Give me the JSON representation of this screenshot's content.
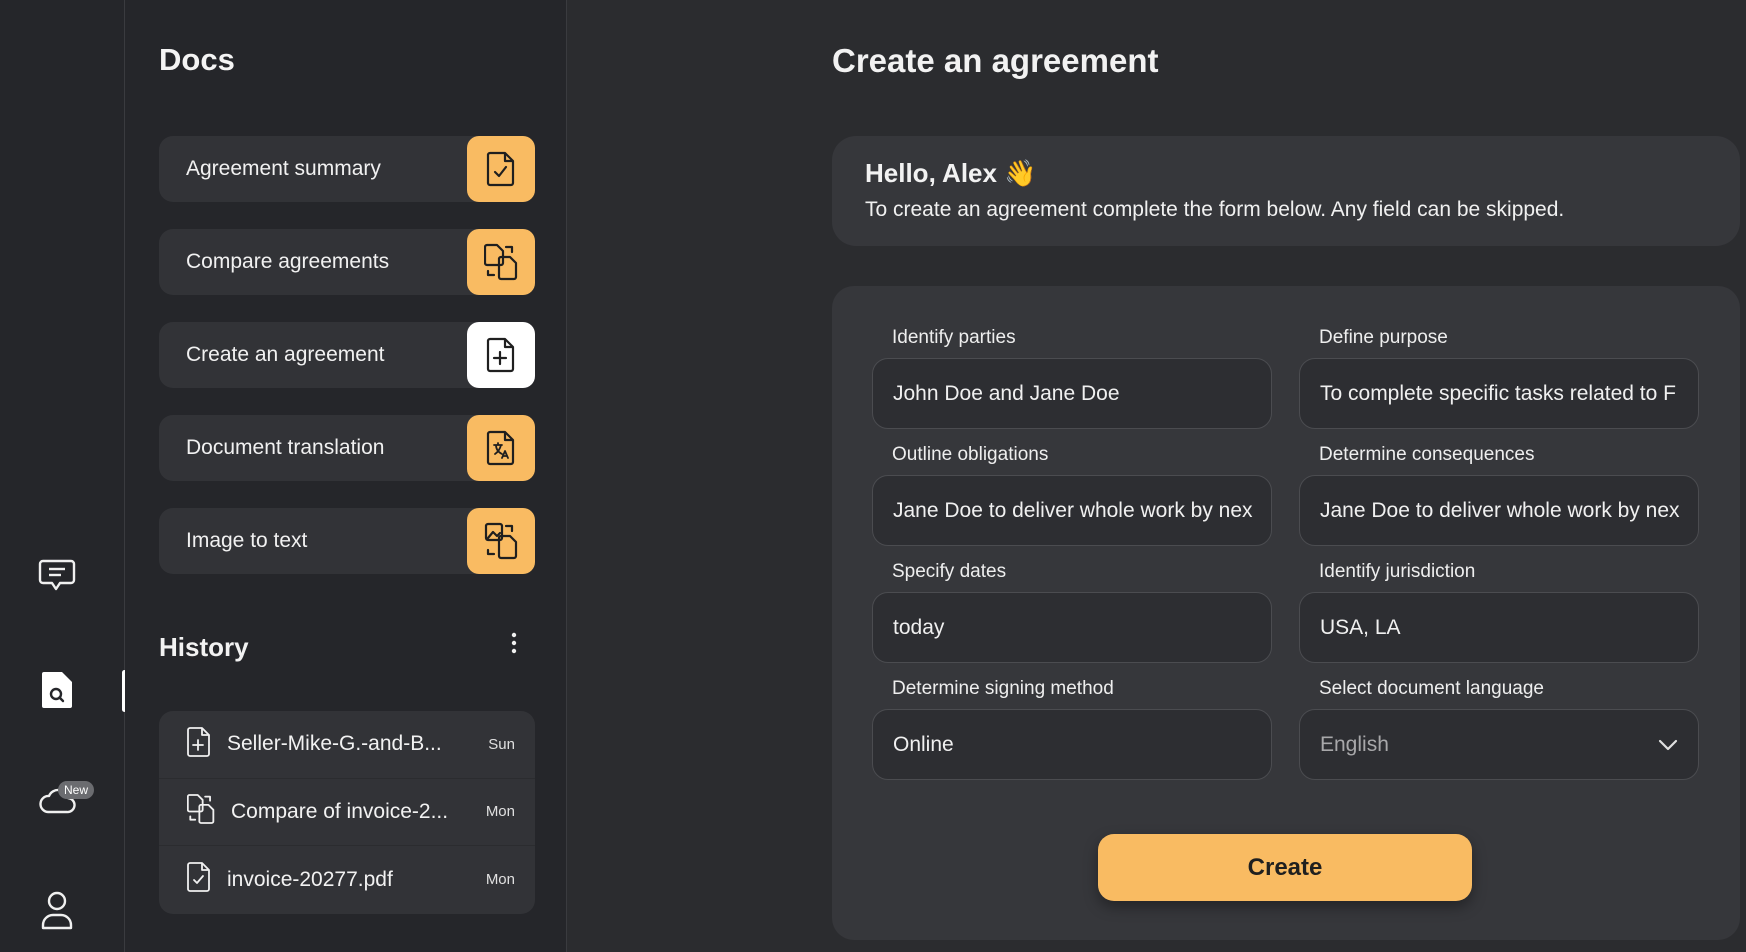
{
  "rail": {
    "items": [
      {
        "name": "chat",
        "icon": "chat-icon"
      },
      {
        "name": "docs",
        "icon": "doc-search-icon",
        "active": true
      },
      {
        "name": "cloud",
        "icon": "cloud-icon",
        "badge": "New"
      },
      {
        "name": "profile",
        "icon": "user-icon"
      }
    ]
  },
  "docs": {
    "title": "Docs",
    "tools": [
      {
        "label": "Agreement summary",
        "icon": "doc-check-icon"
      },
      {
        "label": "Compare agreements",
        "icon": "doc-compare-icon"
      },
      {
        "label": "Create an agreement",
        "icon": "doc-plus-icon",
        "active": true
      },
      {
        "label": "Document translation",
        "icon": "doc-translate-icon"
      },
      {
        "label": "Image to text",
        "icon": "image-text-icon"
      }
    ]
  },
  "history": {
    "title": "History",
    "items": [
      {
        "name": "Seller-Mike-G.-and-B...",
        "day": "Sun",
        "icon": "doc-plus-icon"
      },
      {
        "name": "Compare of invoice-2...",
        "day": "Mon",
        "icon": "doc-compare-icon"
      },
      {
        "name": "invoice-20277.pdf",
        "day": "Mon",
        "icon": "doc-check-icon"
      }
    ]
  },
  "main": {
    "title": "Create an agreement",
    "greeting": {
      "hello": "Hello, Alex 👋",
      "text": "To create an agreement complete the form below. Any field can be skipped."
    },
    "fields": {
      "parties": {
        "label": "Identify parties",
        "value": "John Doe and Jane Doe"
      },
      "purpose": {
        "label": "Define purpose",
        "value": "To complete specific tasks related to F"
      },
      "obligations": {
        "label": "Outline obligations",
        "value": "Jane Doe to deliver whole work by nex"
      },
      "consequences": {
        "label": "Determine consequences",
        "value": "Jane Doe to deliver whole work by nex"
      },
      "dates": {
        "label": "Specify dates",
        "value": "today"
      },
      "jurisdiction": {
        "label": "Identify jurisdiction",
        "value": "USA, LA"
      },
      "signing": {
        "label": "Determine signing method",
        "value": "Online"
      },
      "language": {
        "label": "Select document language",
        "value": "English"
      }
    },
    "create_label": "Create"
  },
  "colors": {
    "accent": "#f9bb62",
    "background": "#2b2c2f",
    "panel": "#25262a",
    "card": "#36373b"
  }
}
